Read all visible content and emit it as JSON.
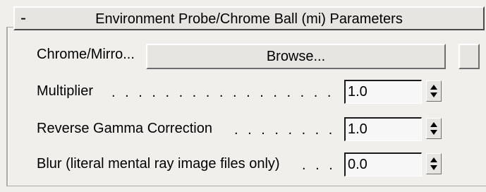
{
  "rollout": {
    "collapse_symbol": "-",
    "title": "Environment Probe/Chrome Ball (mi) Parameters"
  },
  "chrome_map": {
    "label": "Chrome/Mirro...",
    "browse_label": "Browse..."
  },
  "params": [
    {
      "label": "Multiplier",
      "value": "1.0"
    },
    {
      "label": "Reverse Gamma Correction",
      "value": "1.0"
    },
    {
      "label": "Blur (literal mental ray image files only)",
      "value": "0.0"
    }
  ],
  "icons": {
    "collapse": "minus-icon",
    "spinner_up": "triangle-up-icon",
    "spinner_down": "triangle-down-icon"
  },
  "colors": {
    "background": "#f0efec",
    "button_face": "#e6e5e2",
    "field_background": "#f7f7f7"
  }
}
